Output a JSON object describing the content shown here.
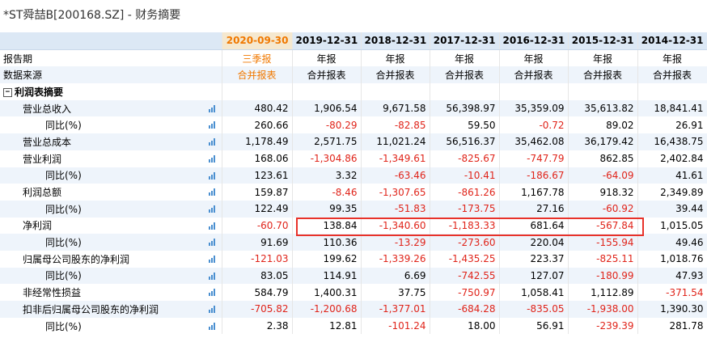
{
  "page_title": "*ST舜喆B[200168.SZ] - 财务摘要",
  "colors": {
    "accent": "#f07800",
    "negative": "#e0241a",
    "highlight": "#e8322a",
    "header_bg": "#dce8f5",
    "row_alt_bg": "#eef4fb"
  },
  "header": {
    "dates": [
      "2020-09-30",
      "2019-12-31",
      "2018-12-31",
      "2017-12-31",
      "2016-12-31",
      "2015-12-31",
      "2014-12-31"
    ]
  },
  "report_period": {
    "label": "报告期",
    "values": [
      "三季报",
      "年报",
      "年报",
      "年报",
      "年报",
      "年报",
      "年报"
    ]
  },
  "data_source": {
    "label": "数据来源",
    "values": [
      "合并报表",
      "合并报表",
      "合并报表",
      "合并报表",
      "合并报表",
      "合并报表",
      "合并报表"
    ]
  },
  "section": {
    "label": "利润表摘要",
    "toggle": "−"
  },
  "rows": [
    {
      "label": "营业总收入",
      "indent": 1,
      "chart": true,
      "values": [
        "480.42",
        "1,906.54",
        "9,671.58",
        "56,398.97",
        "35,359.09",
        "35,613.82",
        "18,841.41"
      ]
    },
    {
      "label": "同比(%)",
      "indent": 2,
      "chart": true,
      "values": [
        "260.66",
        "-80.29",
        "-82.85",
        "59.50",
        "-0.72",
        "89.02",
        "26.91"
      ]
    },
    {
      "label": "营业总成本",
      "indent": 1,
      "chart": true,
      "values": [
        "1,178.49",
        "2,571.75",
        "11,021.24",
        "56,516.37",
        "35,462.08",
        "36,179.42",
        "16,438.75"
      ]
    },
    {
      "label": "营业利润",
      "indent": 1,
      "chart": true,
      "values": [
        "168.06",
        "-1,304.86",
        "-1,349.61",
        "-825.67",
        "-747.79",
        "862.85",
        "2,402.84"
      ]
    },
    {
      "label": "同比(%)",
      "indent": 2,
      "chart": true,
      "values": [
        "123.61",
        "3.32",
        "-63.46",
        "-10.41",
        "-186.67",
        "-64.09",
        "41.61"
      ]
    },
    {
      "label": "利润总额",
      "indent": 1,
      "chart": true,
      "values": [
        "159.87",
        "-8.46",
        "-1,307.65",
        "-861.26",
        "1,167.78",
        "918.32",
        "2,349.89"
      ]
    },
    {
      "label": "同比(%)",
      "indent": 2,
      "chart": true,
      "values": [
        "122.49",
        "99.35",
        "-51.83",
        "-173.75",
        "27.16",
        "-60.92",
        "39.44"
      ]
    },
    {
      "label": "净利润",
      "indent": 1,
      "chart": true,
      "values": [
        "-60.70",
        "138.84",
        "-1,340.60",
        "-1,183.33",
        "681.64",
        "-567.84",
        "1,015.05"
      ]
    },
    {
      "label": "同比(%)",
      "indent": 2,
      "chart": true,
      "values": [
        "91.69",
        "110.36",
        "-13.29",
        "-273.60",
        "220.04",
        "-155.94",
        "49.46"
      ]
    },
    {
      "label": "归属母公司股东的净利润",
      "indent": 1,
      "chart": true,
      "values": [
        "-121.03",
        "199.62",
        "-1,339.26",
        "-1,435.25",
        "223.37",
        "-825.11",
        "1,018.76"
      ]
    },
    {
      "label": "同比(%)",
      "indent": 2,
      "chart": true,
      "values": [
        "83.05",
        "114.91",
        "6.69",
        "-742.55",
        "127.07",
        "-180.99",
        "47.93"
      ]
    },
    {
      "label": "非经常性损益",
      "indent": 1,
      "chart": true,
      "values": [
        "584.79",
        "1,400.31",
        "37.75",
        "-750.97",
        "1,058.41",
        "1,112.89",
        "-371.54"
      ]
    },
    {
      "label": "扣非后归属母公司股东的净利润",
      "indent": 1,
      "chart": true,
      "values": [
        "-705.82",
        "-1,200.68",
        "-1,377.01",
        "-684.28",
        "-835.05",
        "-1,938.00",
        "1,390.30"
      ]
    },
    {
      "label": "同比(%)",
      "indent": 2,
      "chart": true,
      "values": [
        "2.38",
        "12.81",
        "-101.24",
        "18.00",
        "56.91",
        "-239.39",
        "281.78"
      ]
    }
  ]
}
